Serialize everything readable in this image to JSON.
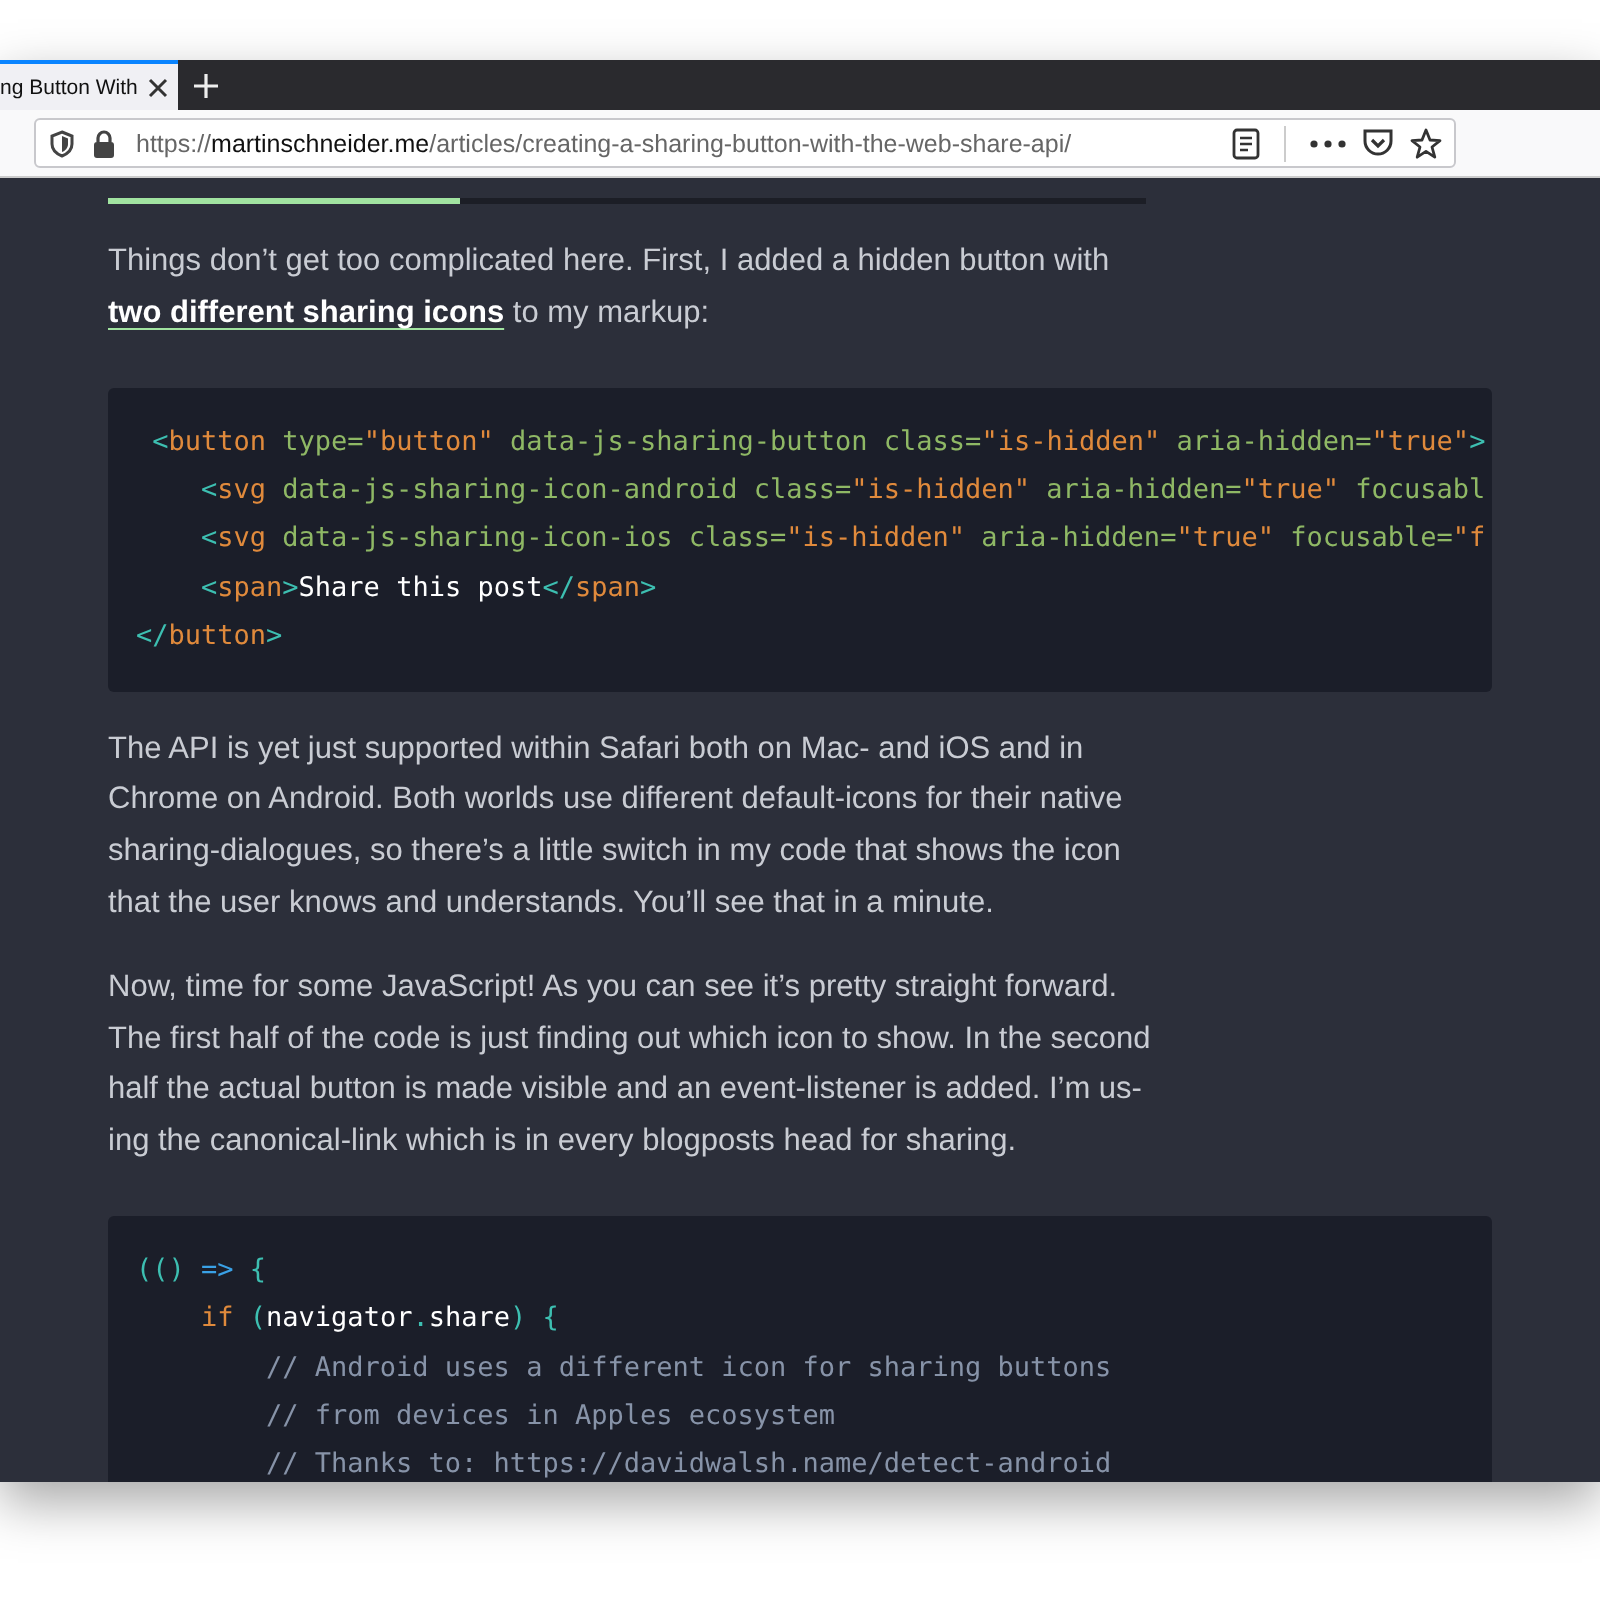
{
  "browser": {
    "tabs": [
      {
        "title": "ng Button With",
        "selected": true
      }
    ],
    "url": {
      "scheme": "https://",
      "domain": "martinschneider.me",
      "path": "/articles/creating-a-sharing-button-with-the-web-share-api/"
    }
  },
  "article": {
    "reading_progress": {
      "level": 0.34
    },
    "blocks": [
      {
        "kind": "paragraph",
        "segments": [
          {
            "kind": "text",
            "text": "Things don’t get too complicated here. First, I added a hidden button with "
          },
          {
            "kind": "link",
            "text": "two different sharing icons"
          },
          {
            "kind": "text",
            "text": " to my markup:"
          }
        ]
      },
      {
        "kind": "code",
        "lines": [
          [
            {
              "kind": "punct",
              "text": " <"
            },
            {
              "kind": "tag",
              "text": "button"
            },
            {
              "kind": "attr",
              "text": " type="
            },
            {
              "kind": "string",
              "text": "\"button\""
            },
            {
              "kind": "attr",
              "text": " data-js-sharing-button class="
            },
            {
              "kind": "string",
              "text": "\"is-hidden\""
            },
            {
              "kind": "attr",
              "text": " aria-hidden="
            },
            {
              "kind": "string",
              "text": "\"true\""
            },
            {
              "kind": "punct",
              "text": ">"
            }
          ],
          [
            {
              "kind": "punct",
              "text": "    <"
            },
            {
              "kind": "tag",
              "text": "svg"
            },
            {
              "kind": "attr",
              "text": " data-js-sharing-icon-android class="
            },
            {
              "kind": "string",
              "text": "\"is-hidden\""
            },
            {
              "kind": "attr",
              "text": " aria-hidden="
            },
            {
              "kind": "string",
              "text": "\"true\""
            },
            {
              "kind": "attr",
              "text": " focusabl"
            }
          ],
          [
            {
              "kind": "punct",
              "text": "    <"
            },
            {
              "kind": "tag",
              "text": "svg"
            },
            {
              "kind": "attr",
              "text": " data-js-sharing-icon-ios class="
            },
            {
              "kind": "string",
              "text": "\"is-hidden\""
            },
            {
              "kind": "attr",
              "text": " aria-hidden="
            },
            {
              "kind": "string",
              "text": "\"true\""
            },
            {
              "kind": "attr",
              "text": " focusable="
            },
            {
              "kind": "string",
              "text": "\"f"
            }
          ],
          [
            {
              "kind": "punct",
              "text": "    <"
            },
            {
              "kind": "tag",
              "text": "span"
            },
            {
              "kind": "punct",
              "text": ">"
            },
            {
              "kind": "plain",
              "text": "Share this post"
            },
            {
              "kind": "punct",
              "text": "</"
            },
            {
              "kind": "tag",
              "text": "span"
            },
            {
              "kind": "punct",
              "text": ">"
            }
          ],
          [
            {
              "kind": "punct",
              "text": "</"
            },
            {
              "kind": "tag",
              "text": "button"
            },
            {
              "kind": "punct",
              "text": ">"
            }
          ]
        ]
      },
      {
        "kind": "paragraph",
        "segments": [
          {
            "kind": "text",
            "text": "The API is yet just supported within Safari both on Mac- and iOS and in Chrome on Android. Both worlds use different default-icons for their native sharing-dialogues, so there’s a little switch in my code that shows the icon that the user knows and understands. You’ll see that in a minute."
          }
        ]
      },
      {
        "kind": "paragraph",
        "segments": [
          {
            "kind": "text",
            "text": "Now, time for some JavaScript! As you can see it’s pretty straight forward. The first half of the code is just finding out which icon to show. In the second half the actual button is made visible and an event-listener is added. I’m us-ing the canonical-link which is in every blogposts head for sharing."
          }
        ]
      },
      {
        "kind": "code",
        "lines": [
          [
            {
              "kind": "punct",
              "text": "(()"
            },
            {
              "kind": "operator",
              "text": " =>"
            },
            {
              "kind": "punct",
              "text": " {"
            }
          ],
          [
            {
              "kind": "keyword",
              "text": "    if"
            },
            {
              "kind": "punct",
              "text": " ("
            },
            {
              "kind": "plain",
              "text": "navigator"
            },
            {
              "kind": "punct",
              "text": "."
            },
            {
              "kind": "plain",
              "text": "share"
            },
            {
              "kind": "punct",
              "text": ")"
            },
            {
              "kind": "punct",
              "text": " {"
            }
          ],
          [
            {
              "kind": "comment",
              "text": "        // Android uses a different icon for sharing buttons"
            }
          ],
          [
            {
              "kind": "comment",
              "text": "        // from devices in Apples ecosystem"
            }
          ],
          [
            {
              "kind": "comment",
              "text": "        // Thanks to: https://davidwalsh.name/detect-android"
            }
          ]
        ]
      }
    ]
  }
}
